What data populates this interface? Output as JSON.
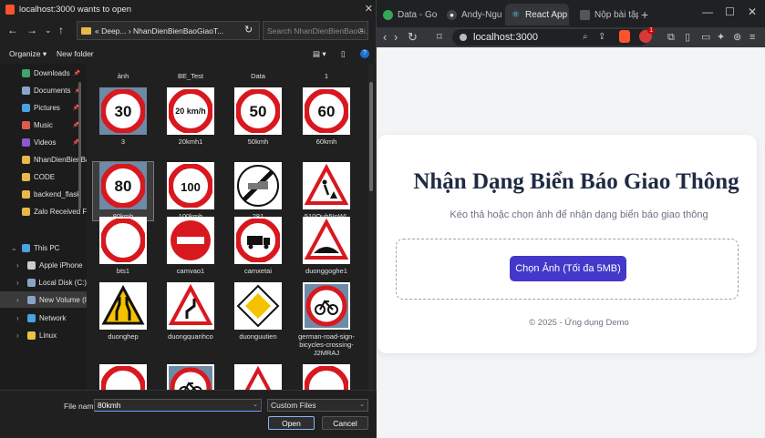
{
  "browser": {
    "tabs": [
      {
        "label": "Data - Google",
        "icon": "google-drive-icon",
        "color": "#34a853"
      },
      {
        "label": "Andy-Nguy/h",
        "icon": "github-icon",
        "color": "#ffffff"
      },
      {
        "label": "React App",
        "icon": "react-icon",
        "color": "#61dafb"
      },
      {
        "label": "Nộp bài tập",
        "icon": "classroom-icon",
        "color": "#e8eaed"
      }
    ],
    "url": "localhost:3000",
    "brave_badge": "1"
  },
  "page": {
    "title": "Nhận Dạng Biển Báo Giao Thông",
    "subtitle": "Kéo thả hoặc chọn ảnh để nhận dạng biển báo giao thông",
    "upload_button": "Chọn Ảnh (Tối đa 5MB)",
    "footer": "© 2025 - Ứng dụng Demo",
    "accent": "#4338ca"
  },
  "dialog": {
    "title": "localhost:3000 wants to open",
    "path": "« Deep... › NhanDienBienBaoGiaoT...",
    "search_placeholder": "Search NhanDienBienBaoGi...",
    "organize": "Organize ▾",
    "new_folder": "New folder",
    "sidebar": [
      {
        "label": "Downloads",
        "icon": "download-icon",
        "color": "#3fa56a",
        "pinned": true
      },
      {
        "label": "Documents",
        "icon": "document-icon",
        "color": "#8aa4c8",
        "pinned": true
      },
      {
        "label": "Pictures",
        "icon": "pictures-icon",
        "color": "#4aa3df",
        "pinned": true
      },
      {
        "label": "Music",
        "icon": "music-icon",
        "color": "#e05a4a",
        "pinned": true
      },
      {
        "label": "Videos",
        "icon": "videos-icon",
        "color": "#8a5ad0",
        "pinned": true
      },
      {
        "label": "NhanDienBienBa",
        "icon": "folder-icon",
        "color": "#e8b84a",
        "pinned": false
      },
      {
        "label": "CODE",
        "icon": "folder-icon",
        "color": "#e8b84a",
        "pinned": false
      },
      {
        "label": "backend_flask",
        "icon": "folder-icon",
        "color": "#e8b84a",
        "pinned": false
      },
      {
        "label": "Zalo Received F",
        "icon": "folder-icon",
        "color": "#e8b84a",
        "pinned": false
      },
      {
        "label": "This PC",
        "icon": "pc-icon",
        "color": "#4aa3df",
        "expand": "⌄"
      },
      {
        "label": "Apple iPhone",
        "icon": "phone-icon",
        "color": "#cccccc",
        "expand": "›"
      },
      {
        "label": "Local Disk (C:)",
        "icon": "disk-icon",
        "color": "#8aa4c8",
        "expand": "›"
      },
      {
        "label": "New Volume (I",
        "icon": "disk-icon",
        "color": "#8aa4c8",
        "expand": "›"
      },
      {
        "label": "Network",
        "icon": "network-icon",
        "color": "#4aa3df",
        "expand": "›"
      },
      {
        "label": "Linux",
        "icon": "linux-icon",
        "color": "#e8c440",
        "expand": "›"
      }
    ],
    "top_row": [
      "ảnh",
      "BE_Test",
      "Data",
      "1"
    ],
    "files": [
      {
        "label": "3",
        "kind": "speed",
        "text": "30"
      },
      {
        "label": "20kmh1",
        "kind": "speed",
        "text": "20 km/h"
      },
      {
        "label": "50kmh",
        "kind": "speed",
        "text": "50"
      },
      {
        "label": "60kmh",
        "kind": "speed",
        "text": "60"
      },
      {
        "label": "80kmh",
        "kind": "speed",
        "text": "80"
      },
      {
        "label": "100kmh",
        "kind": "speed",
        "text": "100"
      },
      {
        "label": "281",
        "kind": "end",
        "text": ""
      },
      {
        "label": "510Ouh5InWL",
        "kind": "warn",
        "text": "worker"
      },
      {
        "label": "bts1",
        "kind": "ring",
        "text": ""
      },
      {
        "label": "camvao1",
        "kind": "noentry",
        "text": ""
      },
      {
        "label": "camxetai",
        "kind": "truck",
        "text": ""
      },
      {
        "label": "duonggoghe1",
        "kind": "warn",
        "text": "bump"
      },
      {
        "label": "duonghep",
        "kind": "narrow",
        "text": ""
      },
      {
        "label": "duongquanhco",
        "kind": "warn",
        "text": "curve"
      },
      {
        "label": "duonguutien",
        "kind": "priority",
        "text": ""
      },
      {
        "label": "german-road-sign-bicycles-crossing-J2MRAJ",
        "kind": "bike",
        "text": ""
      }
    ],
    "file_name_label": "File name:",
    "file_name_value": "80kmh",
    "file_type": "Custom Files",
    "open": "Open",
    "cancel": "Cancel"
  }
}
